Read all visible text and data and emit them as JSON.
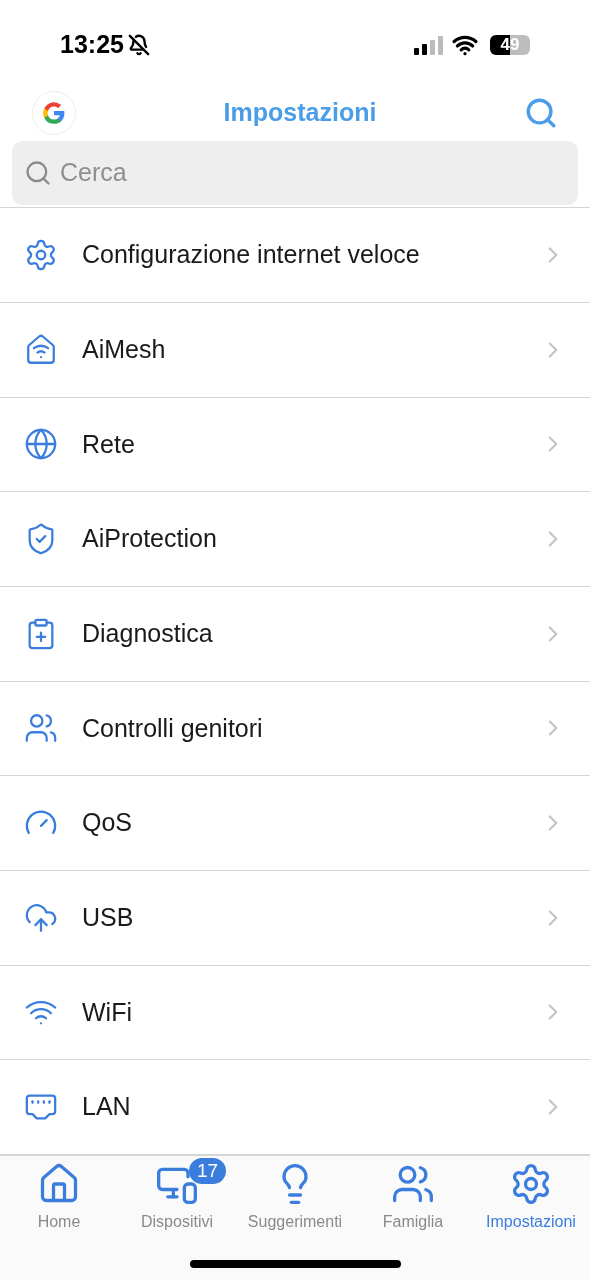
{
  "status_bar": {
    "time": "13:25",
    "battery": "49"
  },
  "header": {
    "title": "Impostazioni"
  },
  "search": {
    "placeholder": "Cerca"
  },
  "menu_items": [
    {
      "label": "Configurazione internet veloce"
    },
    {
      "label": "AiMesh"
    },
    {
      "label": "Rete"
    },
    {
      "label": "AiProtection"
    },
    {
      "label": "Diagnostica"
    },
    {
      "label": "Controlli genitori"
    },
    {
      "label": "QoS"
    },
    {
      "label": "USB"
    },
    {
      "label": "WiFi"
    },
    {
      "label": "LAN"
    }
  ],
  "tab_bar": [
    {
      "label": "Home",
      "selected": false
    },
    {
      "label": "Dispositivi",
      "selected": false,
      "badge": "17"
    },
    {
      "label": "Suggerimenti",
      "selected": false
    },
    {
      "label": "Famiglia",
      "selected": false
    },
    {
      "label": "Impostazioni",
      "selected": true
    }
  ]
}
